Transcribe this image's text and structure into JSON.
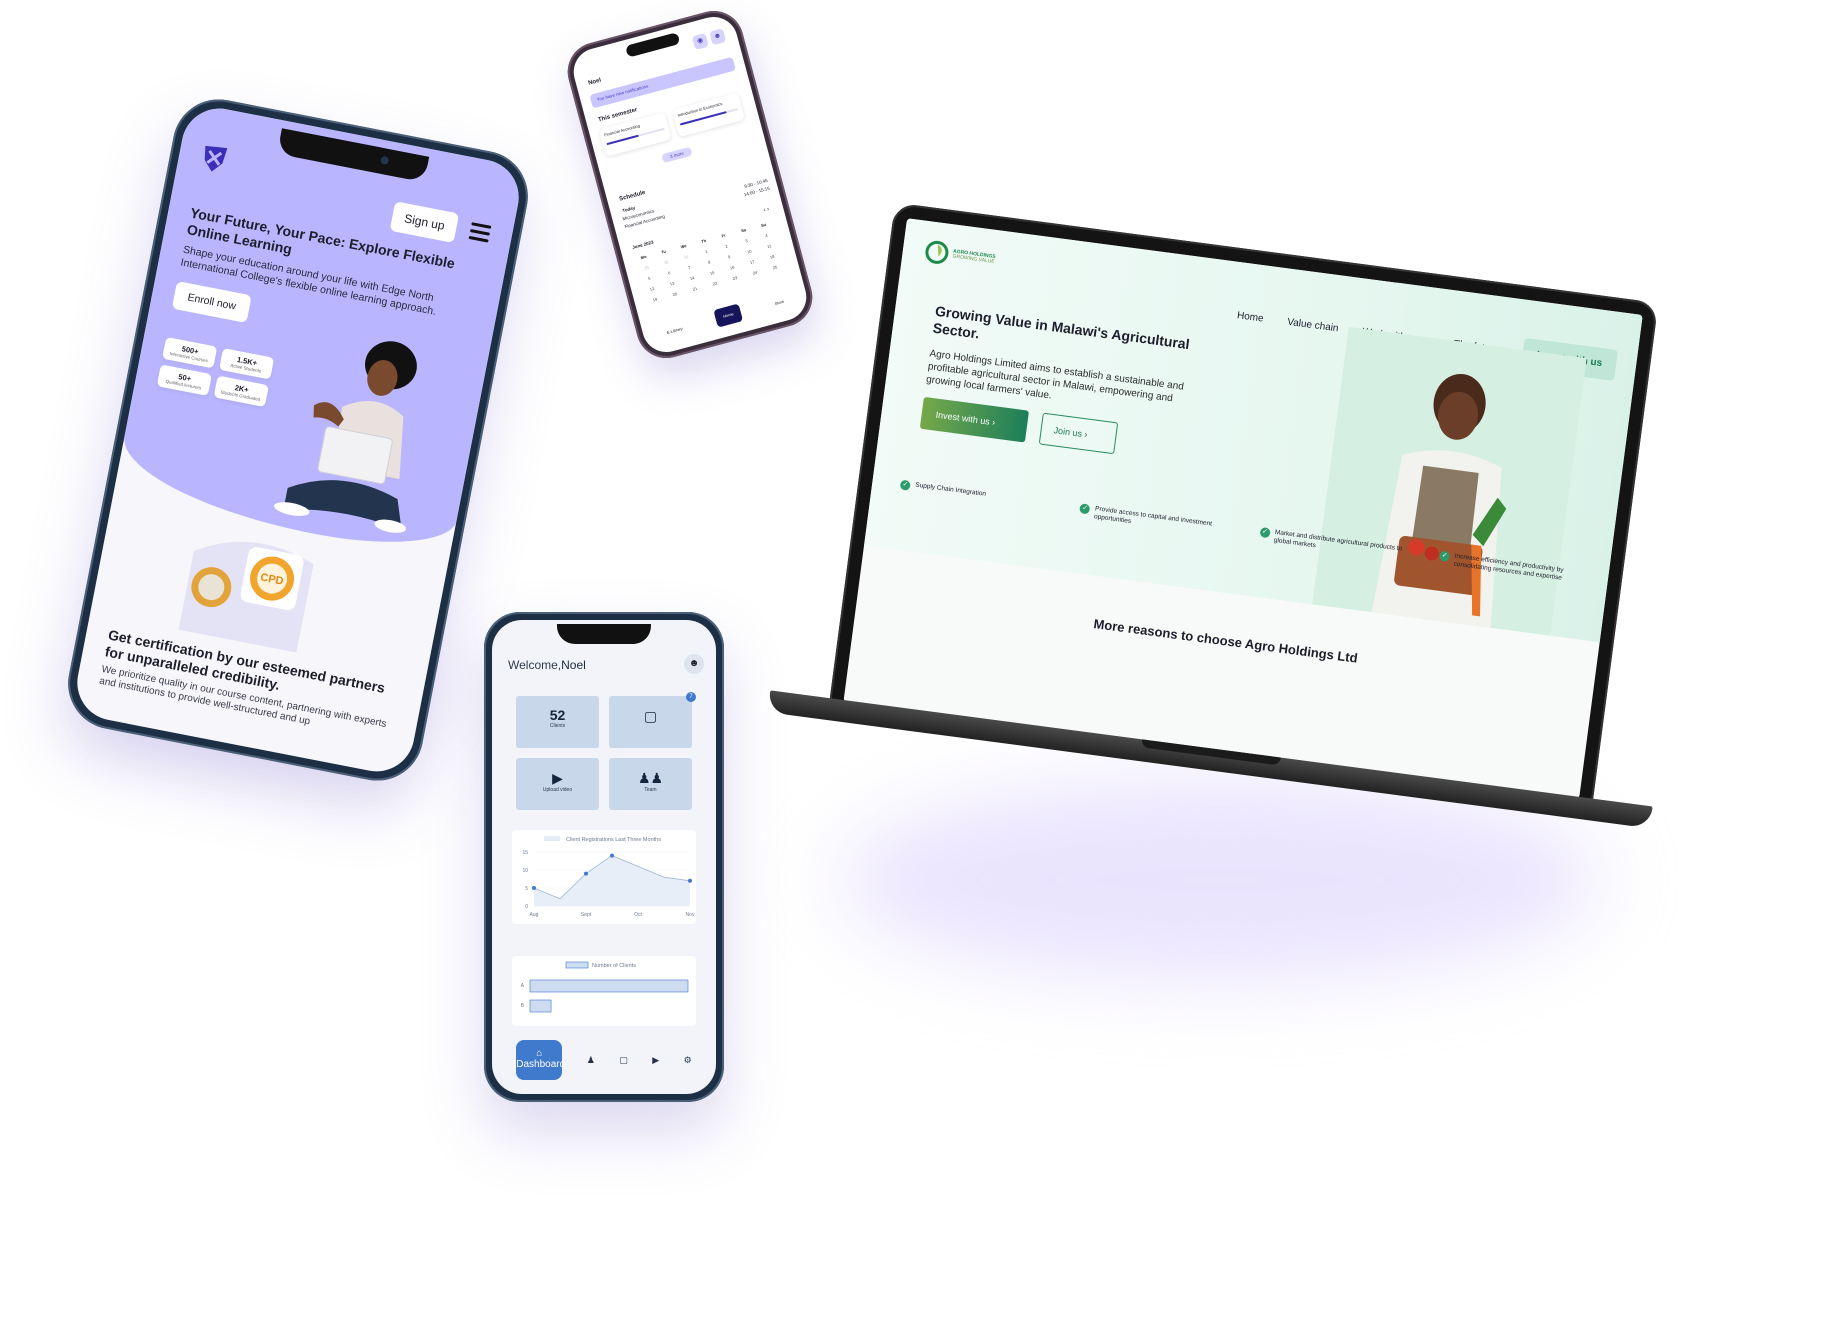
{
  "colors": {
    "lavender": "#b9b6ff",
    "navy": "#1c2f44",
    "dashBlue": "#3f7acc",
    "tile": "#c9d7ea",
    "agroGreen": "#1c7f5a",
    "mint": "#e6f7f0"
  },
  "edgeNorth": {
    "signup": "Sign up",
    "title": "Your Future, Your Pace: Explore Flexible Online Learning",
    "subtitle": "Shape your education around your life with Edge North International College's flexible online learning approach.",
    "enroll": "Enroll now",
    "stats": [
      {
        "value": "500+",
        "label": "Interactive Courses"
      },
      {
        "value": "1.5K+",
        "label": "Active Students"
      },
      {
        "value": "50+",
        "label": "Qualified lecturers"
      },
      {
        "value": "2K+",
        "label": "Students Graduated"
      }
    ],
    "badge": "CPD",
    "certTitle": "Get certification by our esteemed partners for unparalleled credibility.",
    "certText": "We prioritize quality in our course content, partnering with experts and institutions to provide well-structured and up"
  },
  "student": {
    "name": "Noel",
    "notice": "You have new notifications",
    "semester": "This semester",
    "courses": [
      {
        "name": "Financial Accounting",
        "progress": 0.55
      },
      {
        "name": "Introduction to Economics",
        "progress": 0.8
      }
    ],
    "more": "3 more",
    "schedule": "Schedule",
    "today": "Today",
    "items": [
      {
        "course": "Microeconomics",
        "time": "9:30 - 10:45"
      },
      {
        "course": "Financial Accounting",
        "time": "14:00 - 15:15"
      }
    ],
    "month": "June 2023",
    "weekdays": [
      "Mo",
      "Tu",
      "We",
      "Th",
      "Fr",
      "Sa",
      "Su"
    ],
    "nav": [
      "E-Library",
      "Home",
      "Store"
    ]
  },
  "admin": {
    "welcome": "Welcome,",
    "name": "Noel",
    "clientsValue": "52",
    "clientsLabel": "Clients",
    "messagesBadge": "7",
    "uploadLabel": "Upload video",
    "teamLabel": "Team",
    "navActive": "Dashboard",
    "chart_data": [
      {
        "type": "line",
        "title": "Client Registrations Last Three Months",
        "categories": [
          "Aug",
          "Sept",
          "Oct",
          "Nov"
        ],
        "x": [
          0,
          0.5,
          1,
          1.5,
          2,
          2.5,
          3
        ],
        "values": [
          5,
          2,
          9,
          14,
          11,
          8,
          7
        ],
        "yticks": [
          0,
          5,
          10,
          15
        ],
        "ylim": [
          0,
          15
        ]
      },
      {
        "type": "bar",
        "orientation": "horizontal",
        "legend": "Number of Clients",
        "categories": [
          "A",
          "B"
        ],
        "values": [
          30,
          4
        ],
        "xlim": [
          0,
          30
        ]
      }
    ]
  },
  "agro": {
    "brand": "AGRO HOLDINGS",
    "brandTag": "GROWING VALUE",
    "nav": [
      "Home",
      "Value chain",
      "Work with us",
      "The future"
    ],
    "navCta": "Invest with us",
    "title": "Growing Value in Malawi's Agricultural Sector.",
    "text": "Agro Holdings Limited aims to establish a sustainable and profitable agricultural sector in Malawi, empowering and growing local farmers' value.",
    "btnInvest": "Invest with us",
    "btnJoin": "Join us",
    "features": [
      "Supply Chain Integration",
      "Provide access to capital and investment opportunities",
      "Market and distribute agricultural products to global markets",
      "Increase efficiency and productivity by consolidating resources and expertise"
    ],
    "moreTitle": "More reasons to choose Agro Holdings Ltd"
  }
}
